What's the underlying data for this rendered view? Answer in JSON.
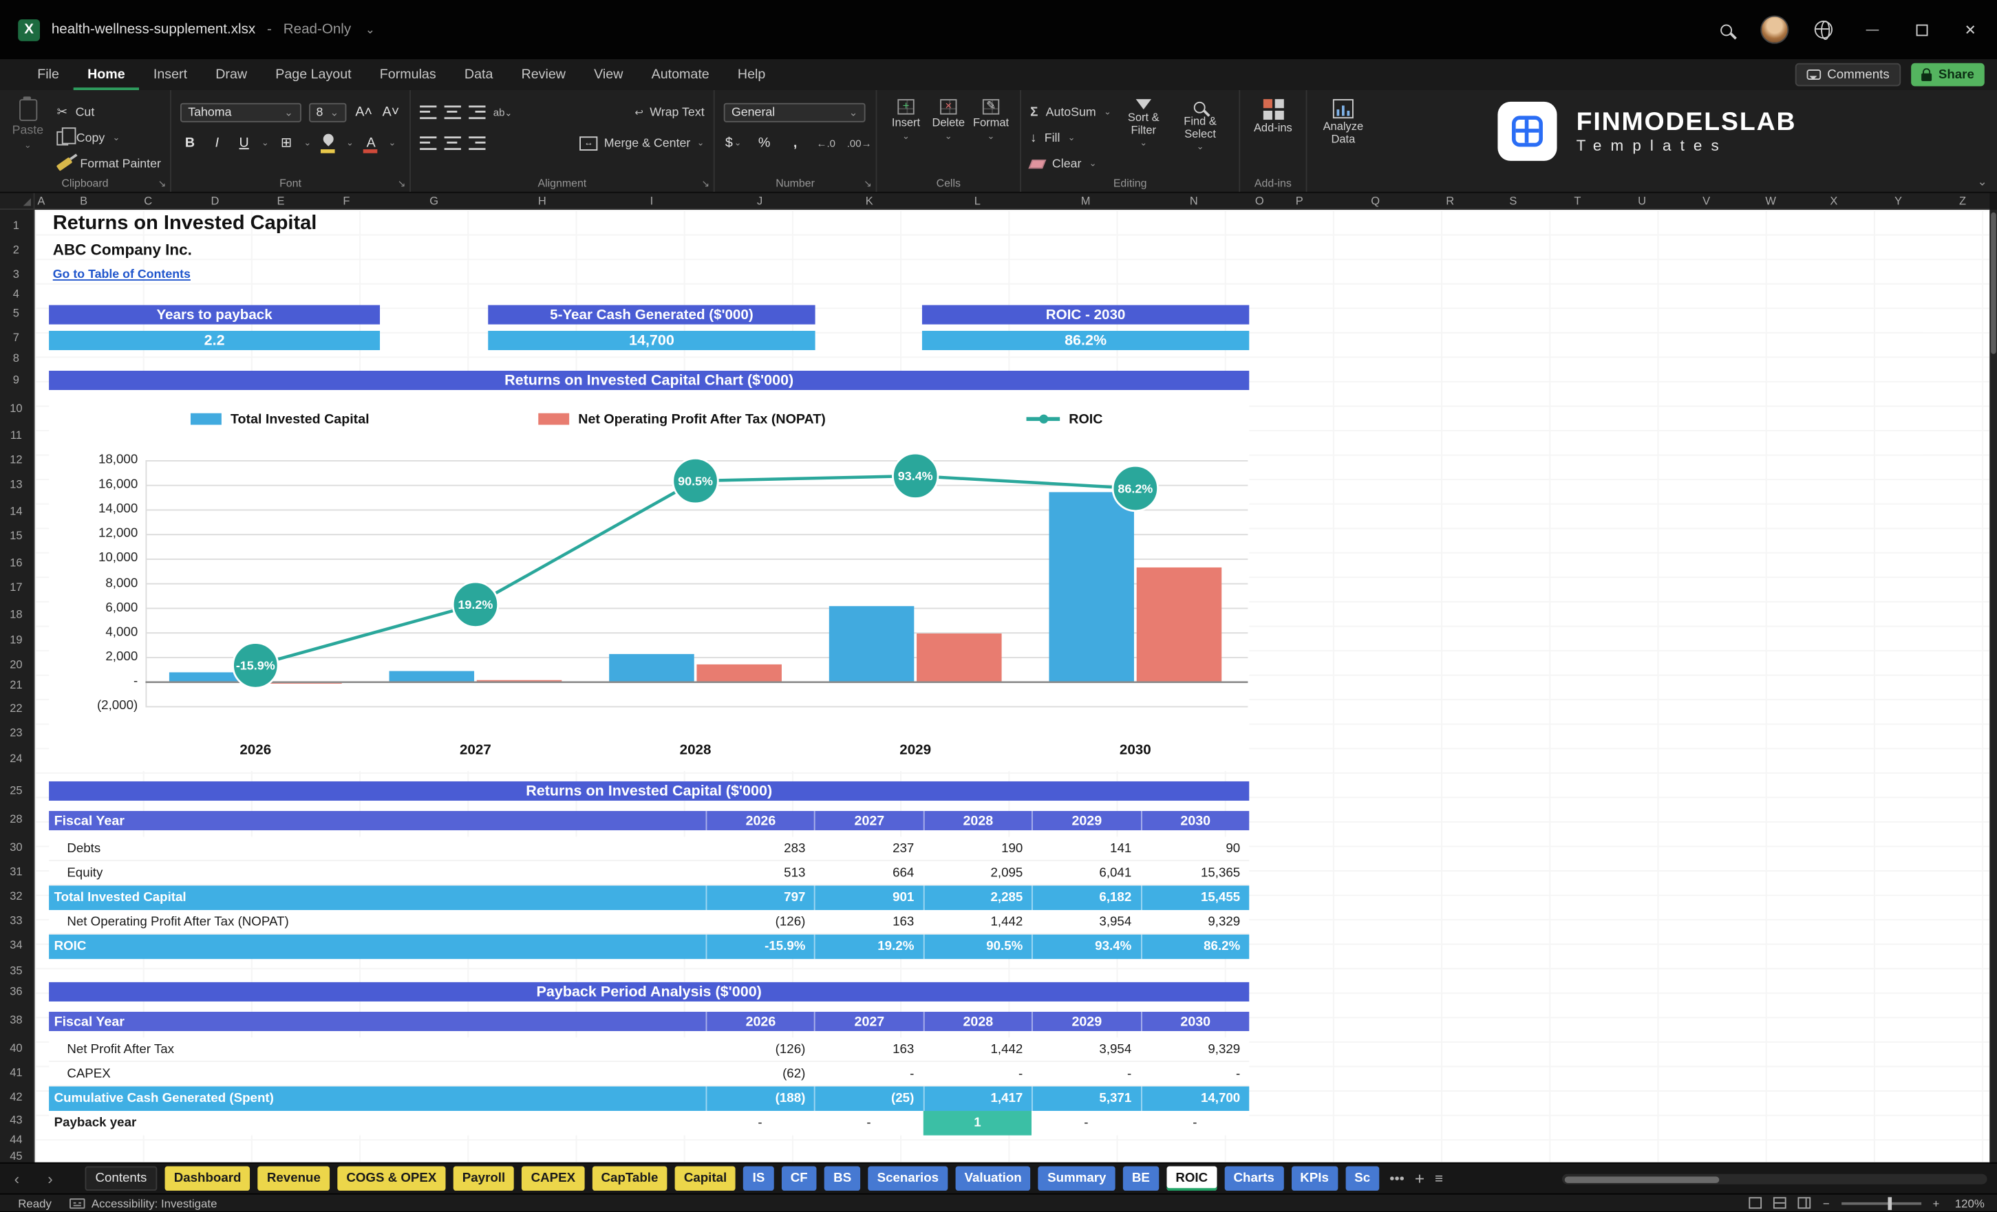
{
  "titlebar": {
    "filename": "health-wellness-supplement.xlsx",
    "separator": "-",
    "mode": "Read-Only"
  },
  "icons": {
    "chevron_down": "⌄",
    "minimize": "—",
    "close": "✕",
    "nav_left": "‹",
    "nav_right": "›",
    "more_tabs": "•••",
    "add_sheet": "+",
    "sheet_list": "≡",
    "scissors": "✂",
    "autosum": "Σ",
    "borders_grid": "⊞",
    "dollar": "$",
    "percent": "%",
    "comma": ",",
    "fill_down": "↓",
    "grow_font": "A˄",
    "shrink_font": "A˅",
    "insert_mark": "+",
    "delete_mark": "×",
    "format_mark": "✎",
    "wrap_mark": "↩",
    "merge_mark": "↔",
    "dec_left": "←.0",
    "dec_right": ".00→"
  },
  "menu": {
    "items": [
      "File",
      "Home",
      "Insert",
      "Draw",
      "Page Layout",
      "Formulas",
      "Data",
      "Review",
      "View",
      "Automate",
      "Help"
    ],
    "active": "Home",
    "comments_label": "Comments",
    "share_label": "Share"
  },
  "ribbon": {
    "clipboard": {
      "paste": "Paste",
      "cut": "Cut",
      "copy": "Copy",
      "format_painter": "Format Painter",
      "group": "Clipboard"
    },
    "font": {
      "family": "Tahoma",
      "size": "8",
      "bold": "B",
      "italic": "I",
      "underline": "U",
      "group": "Font"
    },
    "alignment": {
      "wrap": "Wrap Text",
      "merge": "Merge & Center",
      "group": "Alignment"
    },
    "number": {
      "format": "General",
      "group": "Number"
    },
    "cells": {
      "insert": "Insert",
      "delete": "Delete",
      "format": "Format",
      "group": "Cells"
    },
    "editing": {
      "autosum": "AutoSum",
      "fill": "Fill",
      "clear": "Clear",
      "sort": "Sort & Filter",
      "find": "Find & Select",
      "group": "Editing"
    },
    "addins": {
      "label": "Add-ins",
      "group": "Add-ins"
    },
    "analyze": {
      "label": "Analyze Data"
    },
    "brand": {
      "name": "FINMODELSLAB",
      "sub": "Templates"
    }
  },
  "grid": {
    "columns": [
      "A",
      "B",
      "C",
      "D",
      "E",
      "F",
      "G",
      "H",
      "I",
      "J",
      "K",
      "L",
      "M",
      "N",
      "O",
      "P",
      "Q",
      "R",
      "S",
      "T",
      "U",
      "V",
      "W",
      "X",
      "Y",
      "Z"
    ],
    "row_numbers": [
      1,
      2,
      3,
      4,
      5,
      7,
      8,
      9,
      10,
      11,
      12,
      13,
      14,
      15,
      16,
      17,
      18,
      19,
      20,
      21,
      22,
      23,
      24,
      25,
      28,
      30,
      31,
      32,
      33,
      34,
      35,
      36,
      38,
      40,
      41,
      42,
      43,
      44,
      45
    ]
  },
  "sheet": {
    "title": "Returns on Invested Capital",
    "company": "ABC Company Inc.",
    "toc_link": "Go to Table of Contents",
    "kpis": [
      {
        "label": "Years to payback",
        "value": "2.2"
      },
      {
        "label": "5-Year Cash Generated ($'000)",
        "value": "14,700"
      },
      {
        "label": "ROIC - 2030",
        "value": "86.2%"
      }
    ]
  },
  "chart_data": {
    "type": "bar+line combo",
    "title": "Returns on Invested Capital Chart ($'000)",
    "categories": [
      "2026",
      "2027",
      "2028",
      "2029",
      "2030"
    ],
    "series": [
      {
        "name": "Total Invested Capital",
        "type": "bar",
        "color": "#41aadf",
        "values": [
          797,
          901,
          2285,
          6182,
          15455
        ]
      },
      {
        "name": "Net Operating Profit After Tax (NOPAT)",
        "type": "bar",
        "color": "#e87c70",
        "values": [
          -126,
          163,
          1442,
          3954,
          9329
        ]
      },
      {
        "name": "ROIC",
        "type": "line",
        "axis": "secondary",
        "color": "#2aa79b",
        "values_pct": [
          -15.9,
          19.2,
          90.5,
          93.4,
          86.2
        ],
        "labels": [
          "-15.9%",
          "19.2%",
          "90.5%",
          "93.4%",
          "86.2%"
        ]
      }
    ],
    "y_axis": {
      "min": -2000,
      "max": 18000,
      "step": 2000
    },
    "y_ticks": [
      "18,000",
      "16,000",
      "14,000",
      "12,000",
      "10,000",
      "8,000",
      "6,000",
      "4,000",
      "2,000",
      "-",
      "(2,000)"
    ],
    "grid": true,
    "legend_position": "top"
  },
  "table1": {
    "banner": "Returns on Invested Capital ($'000)",
    "header": [
      "Fiscal Year",
      "2026",
      "2027",
      "2028",
      "2029",
      "2030"
    ],
    "rows": [
      {
        "label": "Debts",
        "style": "plain",
        "values": [
          "283",
          "237",
          "190",
          "141",
          "90"
        ]
      },
      {
        "label": "Equity",
        "style": "plain",
        "values": [
          "513",
          "664",
          "2,095",
          "6,041",
          "15,365"
        ]
      },
      {
        "label": "Total Invested Capital",
        "style": "total",
        "values": [
          "797",
          "901",
          "2,285",
          "6,182",
          "15,455"
        ]
      },
      {
        "label": "Net Operating Profit After Tax (NOPAT)",
        "style": "plain",
        "values": [
          "(126)",
          "163",
          "1,442",
          "3,954",
          "9,329"
        ]
      },
      {
        "label": "ROIC",
        "style": "total",
        "values": [
          "-15.9%",
          "19.2%",
          "90.5%",
          "93.4%",
          "86.2%"
        ]
      }
    ]
  },
  "table2": {
    "banner": "Payback Period Analysis ($'000)",
    "header": [
      "Fiscal Year",
      "2026",
      "2027",
      "2028",
      "2029",
      "2030"
    ],
    "rows": [
      {
        "label": "Net Profit After Tax",
        "style": "plain",
        "values": [
          "(126)",
          "163",
          "1,442",
          "3,954",
          "9,329"
        ]
      },
      {
        "label": "CAPEX",
        "style": "plain",
        "values": [
          "(62)",
          "-",
          "-",
          "-",
          "-"
        ]
      },
      {
        "label": "Cumulative Cash Generated (Spent)",
        "style": "total",
        "values": [
          "(188)",
          "(25)",
          "1,417",
          "5,371",
          "14,700"
        ]
      },
      {
        "label": "Payback year",
        "style": "payback",
        "highlight_index": 2,
        "values": [
          "-",
          "-",
          "1",
          "-",
          "-"
        ]
      }
    ]
  },
  "tabs": {
    "items": [
      {
        "label": "Contents",
        "type": "dark"
      },
      {
        "label": "Dashboard",
        "type": "yellow"
      },
      {
        "label": "Revenue",
        "type": "yellow"
      },
      {
        "label": "COGS & OPEX",
        "type": "yellow"
      },
      {
        "label": "Payroll",
        "type": "yellow"
      },
      {
        "label": "CAPEX",
        "type": "yellow"
      },
      {
        "label": "CapTable",
        "type": "yellow"
      },
      {
        "label": "Capital",
        "type": "yellow"
      },
      {
        "label": "IS",
        "type": "blue"
      },
      {
        "label": "CF",
        "type": "blue"
      },
      {
        "label": "BS",
        "type": "blue"
      },
      {
        "label": "Scenarios",
        "type": "blue"
      },
      {
        "label": "Valuation",
        "type": "blue"
      },
      {
        "label": "Summary",
        "type": "blue"
      },
      {
        "label": "BE",
        "type": "blue"
      },
      {
        "label": "ROIC",
        "type": "active"
      },
      {
        "label": "Charts",
        "type": "blue"
      },
      {
        "label": "KPIs",
        "type": "blue"
      },
      {
        "label": "Sc",
        "type": "blue"
      }
    ]
  },
  "statusbar": {
    "ready": "Ready",
    "accessibility": "Accessibility: Investigate",
    "zoom": "120%",
    "zoom_out": "−",
    "zoom_in": "+"
  },
  "colors": {
    "banner_purple": "#4a5cd4",
    "header_purple": "#5563d6",
    "accent_cyan": "#3fafe4",
    "bar_blue": "#41aadf",
    "bar_salmon": "#e87c70",
    "line_teal": "#2aa79b",
    "payback_teal": "#3bbfa5",
    "tab_yellow": "#ecd64a",
    "tab_blue": "#4679d2",
    "share_green": "#54b45f",
    "link_blue": "#1f55cc"
  }
}
